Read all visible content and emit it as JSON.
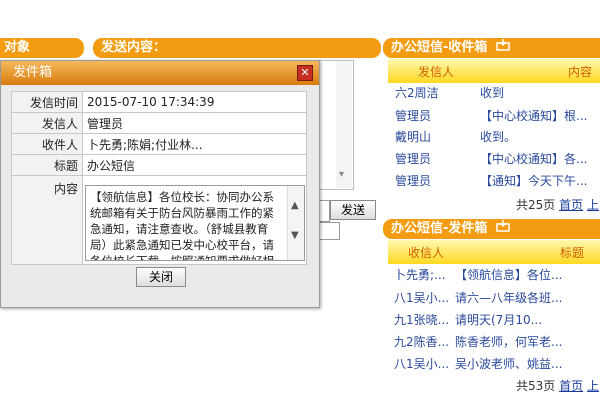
{
  "left_panel": {
    "tab1_label": "对象",
    "tab2_label": "发送内容：",
    "send_button": "发送"
  },
  "inbox": {
    "title": "办公短信-收件箱",
    "col_sender": "发信人",
    "col_content": "内容",
    "rows": [
      {
        "sender": "六2周洁",
        "content": "收到"
      },
      {
        "sender": "管理员",
        "content": "【中心校通知】根..."
      },
      {
        "sender": "戴明山",
        "content": "收到。"
      },
      {
        "sender": "管理员",
        "content": "【中心校通知】各..."
      },
      {
        "sender": "管理员",
        "content": "【通知】今天下午..."
      }
    ],
    "pager_count": "共25页",
    "pager_first": "首页",
    "pager_next": "上"
  },
  "outbox": {
    "title": "办公短信-发件箱",
    "col_receiver": "收信人",
    "col_subject": "标题",
    "rows": [
      {
        "receiver": "卜先勇;...",
        "subject": "【领航信息】各位..."
      },
      {
        "receiver": "八1吴小...",
        "subject": "请六—八年级各班..."
      },
      {
        "receiver": "九1张晓...",
        "subject": "请明天(7月10..."
      },
      {
        "receiver": "九2陈香...",
        "subject": "陈香老师，何军老..."
      },
      {
        "receiver": "八1吴小...",
        "subject": "吴小波老师、姚益..."
      }
    ],
    "pager_count": "共53页",
    "pager_first": "首页",
    "pager_next": "上"
  },
  "dialog": {
    "title": "发件箱",
    "label_time": "发信时间",
    "value_time": "2015-07-10 17:34:39",
    "label_sender": "发信人",
    "value_sender": "管理员",
    "label_receiver": "收件人",
    "value_receiver": "卜先勇;陈娟;付业林...",
    "label_subject": "标题",
    "value_subject": "办公短信",
    "label_content": "内容",
    "value_content": "【领航信息】各位校长：协同办公系统邮箱有关于防台风防暴雨工作的紧急通知，请注意查收。（舒城县教育局）此紧急通知已发中心校平台，请各位校长下载，按照通知要求做好相关工作，王",
    "close_button": "关闭"
  },
  "colors": {
    "accent_orange": "#f39c12",
    "header_yellow": "#ffd820",
    "link_blue": "#2a4a9c"
  }
}
